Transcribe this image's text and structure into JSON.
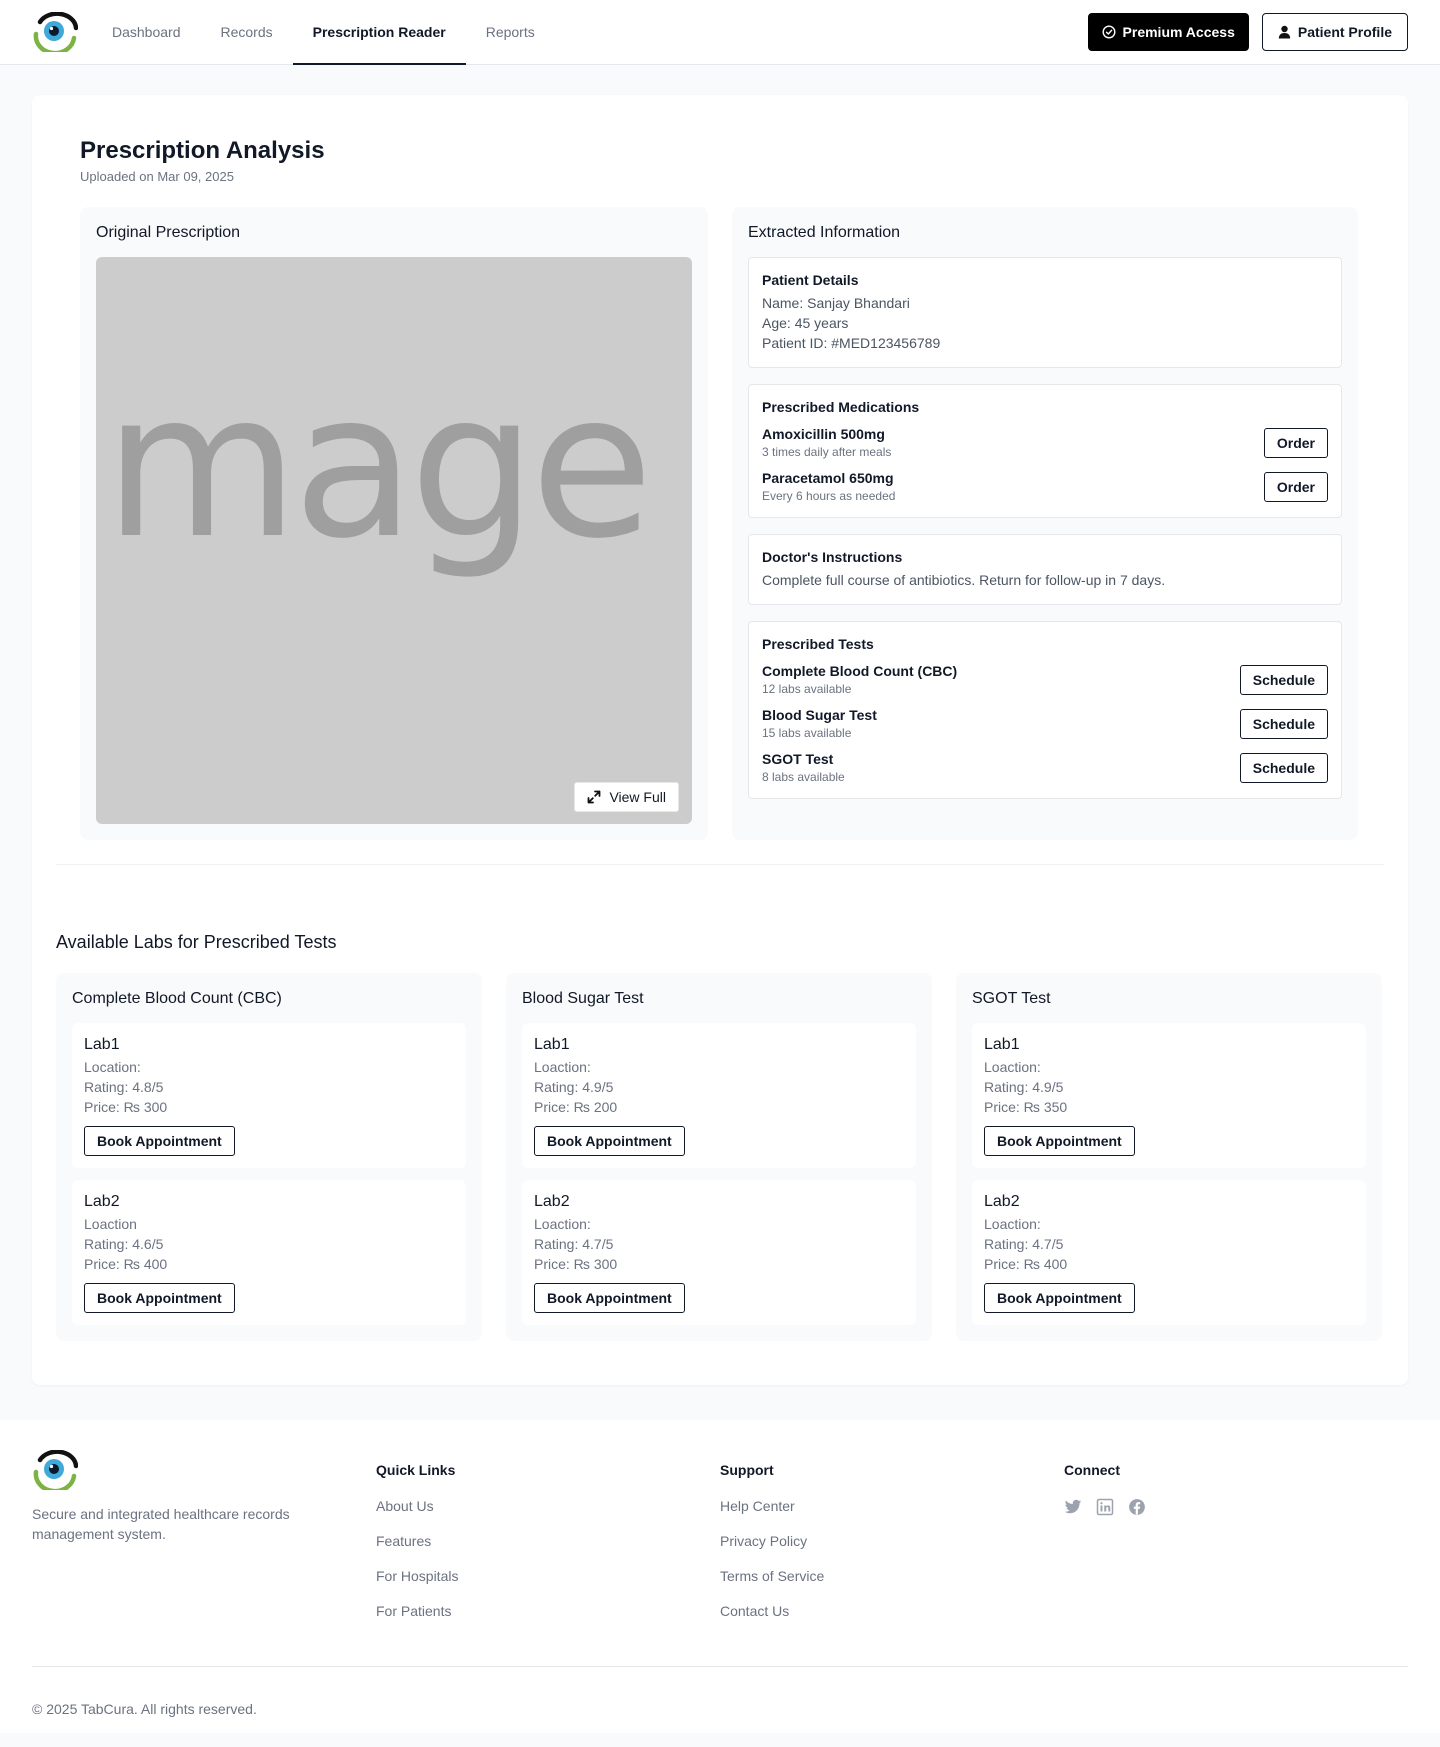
{
  "nav": {
    "items": [
      {
        "label": "Dashboard",
        "active": false
      },
      {
        "label": "Records",
        "active": false
      },
      {
        "label": "Prescription Reader",
        "active": true
      },
      {
        "label": "Reports",
        "active": false
      }
    ],
    "premium_label": "Premium Access",
    "profile_label": "Patient Profile"
  },
  "analysis": {
    "title": "Prescription Analysis",
    "uploaded": "Uploaded on Mar 09, 2025"
  },
  "original": {
    "title": "Original Prescription",
    "placeholder_text": "mage",
    "view_full_label": "View Full"
  },
  "extracted": {
    "title": "Extracted Information",
    "patient": {
      "title": "Patient Details",
      "name": "Name: Sanjay Bhandari",
      "age": "Age: 45 years",
      "id": "Patient ID: #MED123456789"
    },
    "medications": {
      "title": "Prescribed Medications",
      "items": [
        {
          "name": "Amoxicillin 500mg",
          "dose": "3 times daily after meals",
          "action": "Order"
        },
        {
          "name": "Paracetamol 650mg",
          "dose": "Every 6 hours as needed",
          "action": "Order"
        }
      ]
    },
    "instructions": {
      "title": "Doctor's Instructions",
      "text": "Complete full course of antibiotics. Return for follow-up in 7 days."
    },
    "tests": {
      "title": "Prescribed Tests",
      "items": [
        {
          "name": "Complete Blood Count (CBC)",
          "availability": "12 labs available",
          "action": "Schedule"
        },
        {
          "name": "Blood Sugar Test",
          "availability": "15 labs available",
          "action": "Schedule"
        },
        {
          "name": "SGOT Test",
          "availability": "8 labs available",
          "action": "Schedule"
        }
      ]
    }
  },
  "labs": {
    "title": "Available Labs for Prescribed Tests",
    "groups": [
      {
        "test": "Complete Blood Count (CBC)",
        "labs": [
          {
            "name": "Lab1",
            "location": "Location:",
            "rating": "Rating: 4.8/5",
            "price": "Price:  ₨ 300",
            "action": "Book Appointment"
          },
          {
            "name": "Lab2",
            "location": "Loaction",
            "rating": "Rating: 4.6/5",
            "price": "Price: ₨ 400",
            "action": "Book Appointment"
          }
        ]
      },
      {
        "test": "Blood Sugar Test",
        "labs": [
          {
            "name": "Lab1",
            "location": "Loaction:",
            "rating": "Rating: 4.9/5",
            "price": "Price: ₨ 200",
            "action": "Book Appointment"
          },
          {
            "name": "Lab2",
            "location": "Loaction:",
            "rating": "Rating: 4.7/5",
            "price": "Price: ₨ 300",
            "action": "Book Appointment"
          }
        ]
      },
      {
        "test": "SGOT Test",
        "labs": [
          {
            "name": "Lab1",
            "location": "Loaction:",
            "rating": "Rating: 4.9/5",
            "price": "Price: ₨ 350",
            "action": "Book Appointment"
          },
          {
            "name": "Lab2",
            "location": "Loaction:",
            "rating": "Rating: 4.7/5",
            "price": "Price: ₨ 400",
            "action": "Book Appointment"
          }
        ]
      }
    ]
  },
  "footer": {
    "tagline": "Secure and integrated healthcare records management system.",
    "quick_links": {
      "title": "Quick Links",
      "items": [
        "About Us",
        "Features",
        "For Hospitals",
        "For Patients"
      ]
    },
    "support": {
      "title": "Support",
      "items": [
        "Help Center",
        "Privacy Policy",
        "Terms of Service",
        "Contact Us"
      ]
    },
    "connect": {
      "title": "Connect",
      "icons": [
        "twitter-icon",
        "linkedin-icon",
        "facebook-icon"
      ]
    },
    "copyright": "© 2025 TabCura. All rights reserved."
  },
  "colors": {
    "text_primary": "#111827",
    "text_muted": "#6b7280",
    "panel_bg": "#f9fafb",
    "image_placeholder_bg": "#cccccc",
    "logo_green": "#7cb342",
    "logo_blue": "#3fa9d9"
  }
}
